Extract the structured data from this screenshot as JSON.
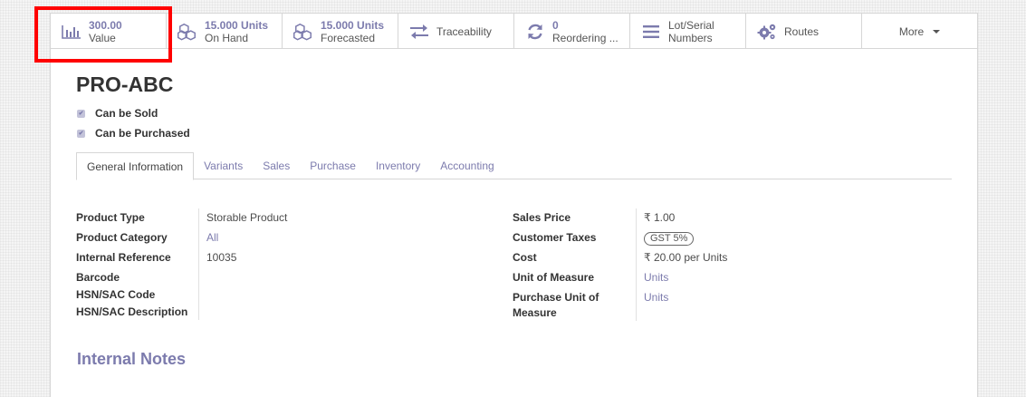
{
  "stat_buttons": [
    {
      "icon": "bar-chart-icon",
      "value": "300.00",
      "label": "Value"
    },
    {
      "icon": "cubes-icon",
      "value": "15.000 Units",
      "label": "On Hand"
    },
    {
      "icon": "cubes-icon",
      "value": "15.000 Units",
      "label": "Forecasted"
    },
    {
      "icon": "exchange-icon",
      "label": "Traceability"
    },
    {
      "icon": "refresh-icon",
      "value": "0",
      "label": "Reordering ..."
    },
    {
      "icon": "list-icon",
      "value": "Lot/Serial",
      "label": "Numbers"
    },
    {
      "icon": "cogs-icon",
      "label": "Routes"
    },
    {
      "icon": "caret-down-icon",
      "label": "More"
    }
  ],
  "product": {
    "name": "PRO-ABC",
    "can_be_sold": "Can be Sold",
    "can_be_purchased": "Can be Purchased"
  },
  "tabs": [
    "General Information",
    "Variants",
    "Sales",
    "Purchase",
    "Inventory",
    "Accounting"
  ],
  "left_fields": [
    {
      "label": "Product Type",
      "value": "Storable Product"
    },
    {
      "label": "Product Category",
      "value": "All"
    },
    {
      "label": "Internal Reference",
      "value": "10035"
    },
    {
      "label": "Barcode",
      "value": ""
    },
    {
      "label": "HSN/SAC Code",
      "value": ""
    },
    {
      "label": "HSN/SAC Description",
      "value": ""
    }
  ],
  "right_fields": [
    {
      "label": "Sales Price",
      "value": "₹ 1.00"
    },
    {
      "label": "Customer Taxes",
      "value": "GST 5%"
    },
    {
      "label": "Cost",
      "value": "₹ 20.00  per Units"
    },
    {
      "label": "Unit of Measure",
      "value": "Units"
    },
    {
      "label": "Purchase Unit of Measure",
      "value": "Units"
    }
  ],
  "notes_title": "Internal Notes",
  "colors": {
    "accent": "#7c7bad",
    "highlight": "#ff0000"
  }
}
